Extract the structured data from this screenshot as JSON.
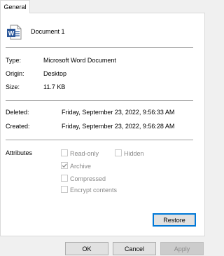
{
  "tabs": [
    {
      "label": "General",
      "selected": true
    }
  ],
  "file": {
    "name": "Document 1",
    "icon": "word-document-icon"
  },
  "info": [
    {
      "label": "Type:",
      "value": "Microsoft Word Document"
    },
    {
      "label": "Origin:",
      "value": "Desktop"
    },
    {
      "label": "Size:",
      "value": "11.7 KB"
    }
  ],
  "dates": [
    {
      "label": "Deleted:",
      "value": "Friday, September 23, 2022, 9:56:33 AM"
    },
    {
      "label": "Created:",
      "value": "Friday, September 23, 2022, 9:56:28 AM"
    }
  ],
  "attributes": {
    "heading": "Attributes",
    "read_only": {
      "label": "Read-only",
      "checked": false
    },
    "hidden": {
      "label": "Hidden",
      "checked": false
    },
    "archive": {
      "label": "Archive",
      "checked": true
    },
    "compressed": {
      "label": "Compressed",
      "checked": false
    },
    "encrypt": {
      "label": "Encrypt contents",
      "checked": false
    }
  },
  "restore_label": "Restore",
  "footer": {
    "ok": "OK",
    "cancel": "Cancel",
    "apply": "Apply"
  },
  "colors": {
    "word_blue": "#2b579a",
    "focus_blue": "#0078d7",
    "disabled_text": "#8a8a8a"
  }
}
